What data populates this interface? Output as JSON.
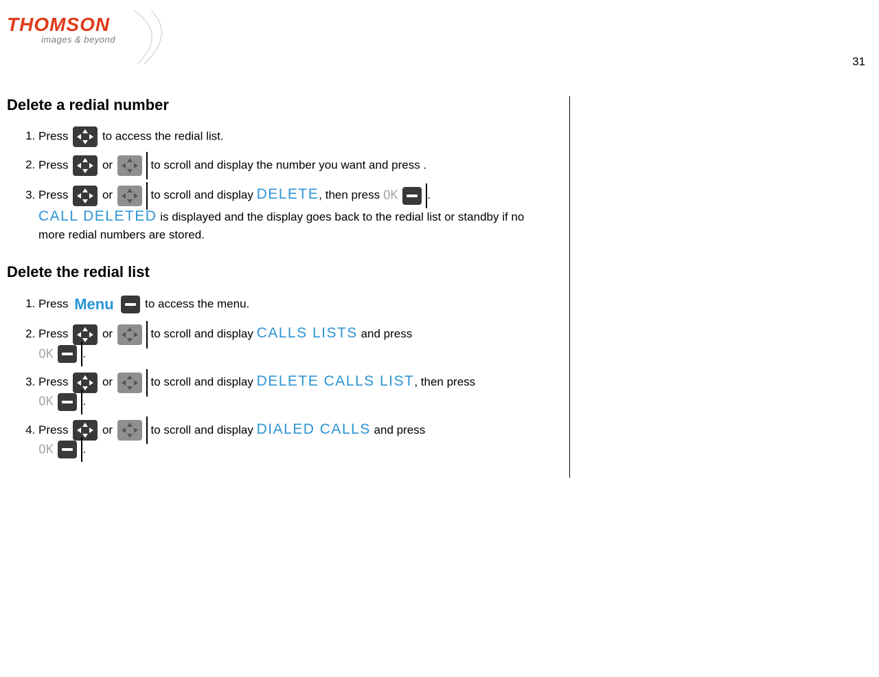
{
  "logo": {
    "brand": "THOMSON",
    "tagline": "images & beyond"
  },
  "pageNumber": "31",
  "section1": {
    "title": "Delete a redial number",
    "steps": {
      "s1": {
        "press": "Press",
        "t1": "to access the redial list."
      },
      "s2": {
        "press": "Press",
        "or": "or",
        "t1": "to scroll and display the number you want and press ."
      },
      "s3": {
        "press": "Press",
        "or": "or",
        "t1": "to scroll and display",
        "delete": "DELETE",
        "t2": ", then press",
        "ok": "OK",
        "dot": ".",
        "calldeleted": "CALL DELETED",
        "t3": "is displayed and the display goes back to the redial list or standby if no more redial numbers are stored."
      }
    }
  },
  "section2": {
    "title": "Delete the redial list",
    "steps": {
      "s1": {
        "press": "Press",
        "menu": "Menu",
        "t1": "to access the menu."
      },
      "s2": {
        "press": "Press",
        "or": "or",
        "t1": "to scroll and display",
        "callslists": "CALLS LISTS",
        "t2": "and press",
        "ok": "OK",
        "dot": "."
      },
      "s3": {
        "press": "Press",
        "or": "or",
        "t1": "to scroll and display",
        "dcl": "DELETE CALLS LIST",
        "t2": ", then press",
        "ok": "OK",
        "dot": "."
      },
      "s4": {
        "press": "Press",
        "or": "or",
        "t1": "to scroll and display",
        "dialed": "DIALED CALLS",
        "t2": "and press",
        "ok": "OK",
        "dot": "."
      }
    }
  }
}
